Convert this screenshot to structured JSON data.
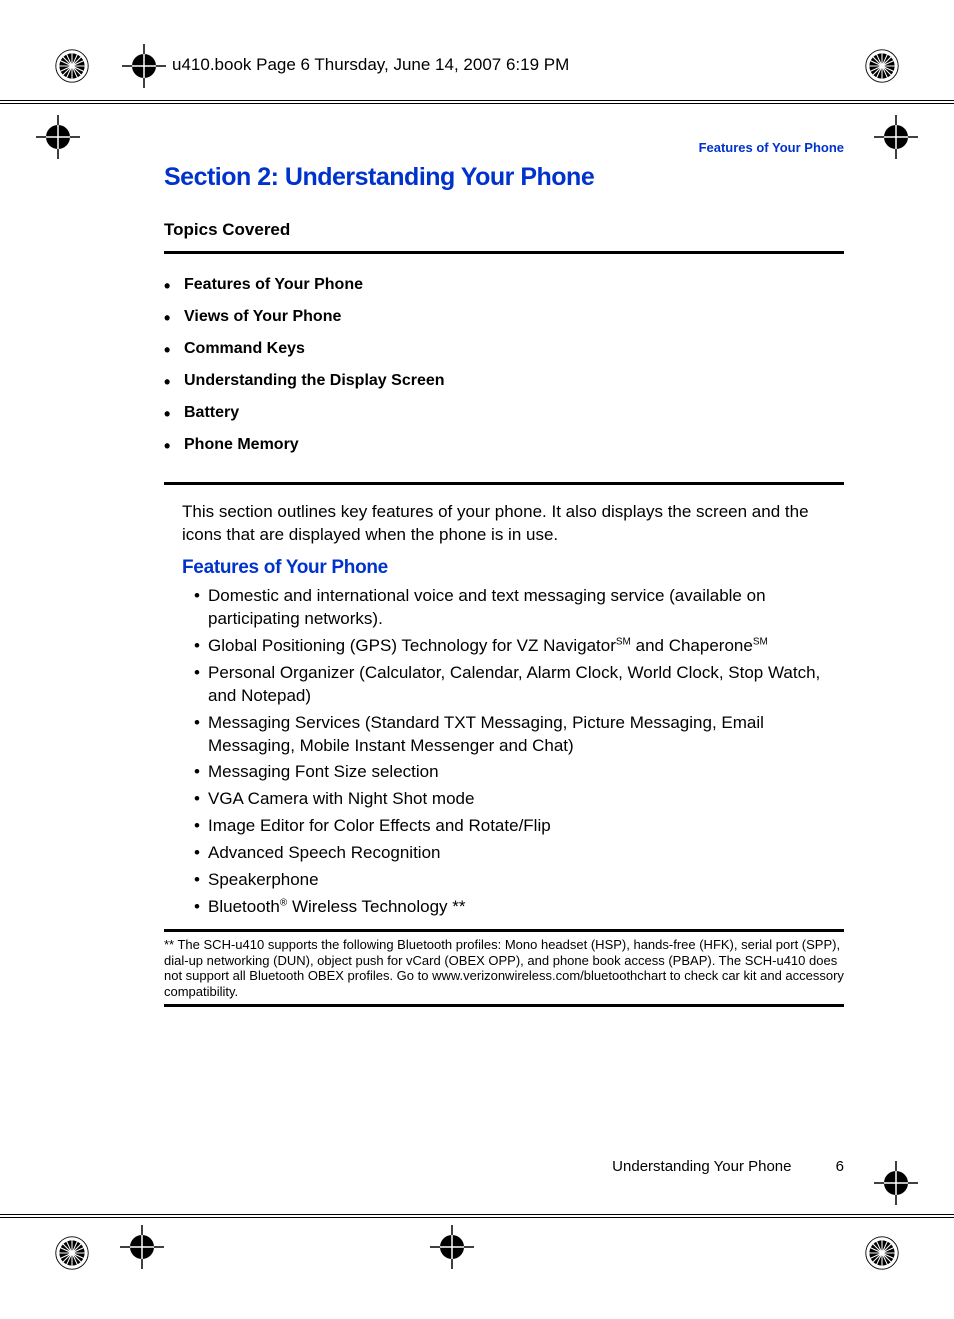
{
  "header": {
    "file_info": "u410.book  Page 6  Thursday, June 14, 2007  6:19 PM"
  },
  "section": {
    "label": "Features of Your Phone",
    "title": "Section 2: Understanding Your Phone"
  },
  "topics": {
    "header": "Topics Covered",
    "items": [
      "Features of Your Phone",
      "Views of Your Phone",
      "Command Keys",
      "Understanding the Display Screen",
      "Battery",
      "Phone Memory"
    ]
  },
  "intro": "This section outlines key features of your phone. It also displays the screen and the icons that are displayed when the phone is in use.",
  "features": {
    "heading": "Features of Your Phone",
    "items": [
      {
        "text_before": "Domestic and international voice and text messaging service (available on participating networks).",
        "sup": "",
        "text_after": ""
      },
      {
        "text_before": "Global Positioning (GPS) Technology for VZ Navigator",
        "sup": "SM",
        "text_after": " and Chaperone",
        "sup2": "SM"
      },
      {
        "text_before": " Personal Organizer (Calculator, Calendar, Alarm Clock, World Clock, Stop Watch, and Notepad)",
        "sup": "",
        "text_after": ""
      },
      {
        "text_before": "Messaging Services (Standard TXT Messaging, Picture Messaging, Email Messaging, Mobile Instant Messenger and Chat)",
        "sup": "",
        "text_after": ""
      },
      {
        "text_before": "Messaging Font Size selection",
        "sup": "",
        "text_after": ""
      },
      {
        "text_before": "VGA Camera with Night Shot mode",
        "sup": "",
        "text_after": ""
      },
      {
        "text_before": "Image Editor for Color Effects and Rotate/Flip",
        "sup": "",
        "text_after": ""
      },
      {
        "text_before": "Advanced Speech Recognition",
        "sup": "",
        "text_after": ""
      },
      {
        "text_before": "Speakerphone",
        "sup": "",
        "text_after": ""
      },
      {
        "text_before": "Bluetooth",
        "sup": "®",
        "text_after": " Wireless Technology **"
      }
    ]
  },
  "footnote": "** The SCH-u410 supports the following Bluetooth profiles: Mono headset (HSP), hands-free (HFK), serial port (SPP), dial-up networking (DUN), object push for vCard (OBEX OPP), and phone book access (PBAP). The SCH-u410 does not support all Bluetooth OBEX profiles. Go to www.verizonwireless.com/bluetoothchart to check car kit and accessory compatibility.",
  "footer": {
    "chapter": "Understanding Your Phone",
    "page": "6"
  }
}
